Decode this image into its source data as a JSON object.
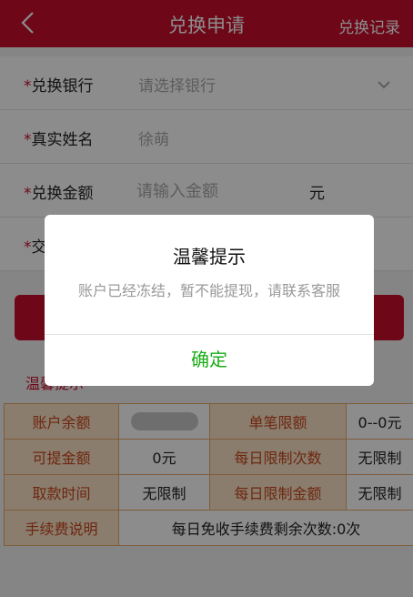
{
  "header": {
    "title": "兑换申请",
    "records_link": "兑换记录"
  },
  "form": {
    "bank": {
      "label": "兑换银行",
      "placeholder": "请选择银行"
    },
    "name": {
      "label": "真实姓名",
      "value": "徐萌"
    },
    "amount": {
      "label": "兑换金额",
      "placeholder": "请输入金额",
      "unit": "元"
    },
    "password": {
      "label": "交"
    }
  },
  "tips": {
    "label": "温馨提示"
  },
  "info_table": {
    "account_balance_label": "账户余额",
    "single_limit_label": "单笔限额",
    "single_limit_value": "0--0元",
    "withdrawable_label": "可提金额",
    "withdrawable_value": "0元",
    "daily_count_label": "每日限制次数",
    "daily_count_value": "无限制",
    "time_label": "取款时间",
    "time_value": "无限制",
    "daily_amount_label": "每日限制金额",
    "daily_amount_value": "无限制",
    "fee_label": "手续费说明",
    "fee_value": "每日免收手续费剩余次数:0次"
  },
  "dialog": {
    "title": "温馨提示",
    "message": "账户已经冻结，暂不能提现，请联系客服",
    "confirm": "确定"
  },
  "colors": {
    "brand": "#c8102e",
    "confirm": "#1aad19",
    "table_header": "#fbe3c6"
  },
  "icons": {
    "back": "chevron-left-icon",
    "dropdown": "chevron-down-icon"
  }
}
